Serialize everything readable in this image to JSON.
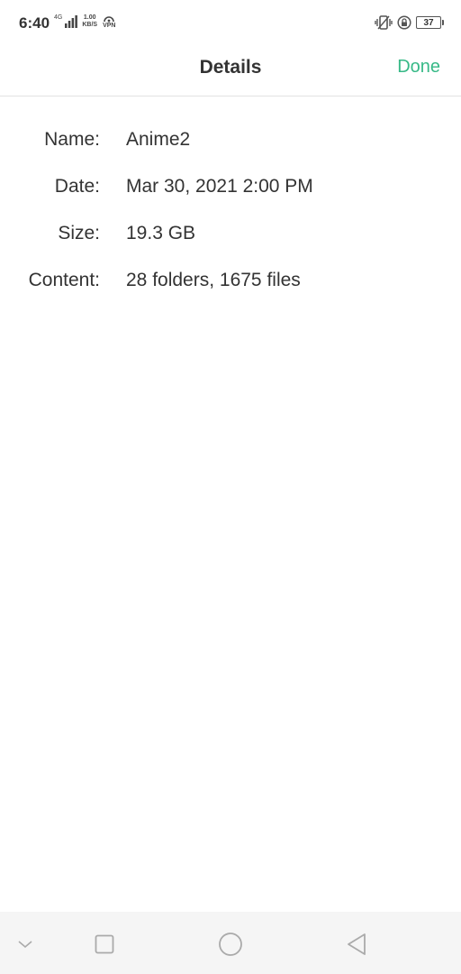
{
  "status_bar": {
    "time": "6:40",
    "network_type": "4G",
    "net_speed_value": "1.00",
    "net_speed_unit": "KB/S",
    "vpn_label": "VPN",
    "battery_level": "37"
  },
  "header": {
    "title": "Details",
    "done_label": "Done"
  },
  "details": [
    {
      "label": "Name:",
      "value": "Anime2"
    },
    {
      "label": "Date:",
      "value": "Mar 30, 2021 2:00 PM"
    },
    {
      "label": "Size:",
      "value": "19.3 GB"
    },
    {
      "label": "Content:",
      "value": "28 folders, 1675 files"
    }
  ],
  "colors": {
    "accent": "#37b987",
    "text": "#333333",
    "nav_background": "#f5f5f5"
  },
  "icons": {
    "nav_hide": "chevron-down-icon",
    "nav_recents": "square-icon",
    "nav_home": "circle-icon",
    "nav_back": "triangle-back-icon"
  }
}
